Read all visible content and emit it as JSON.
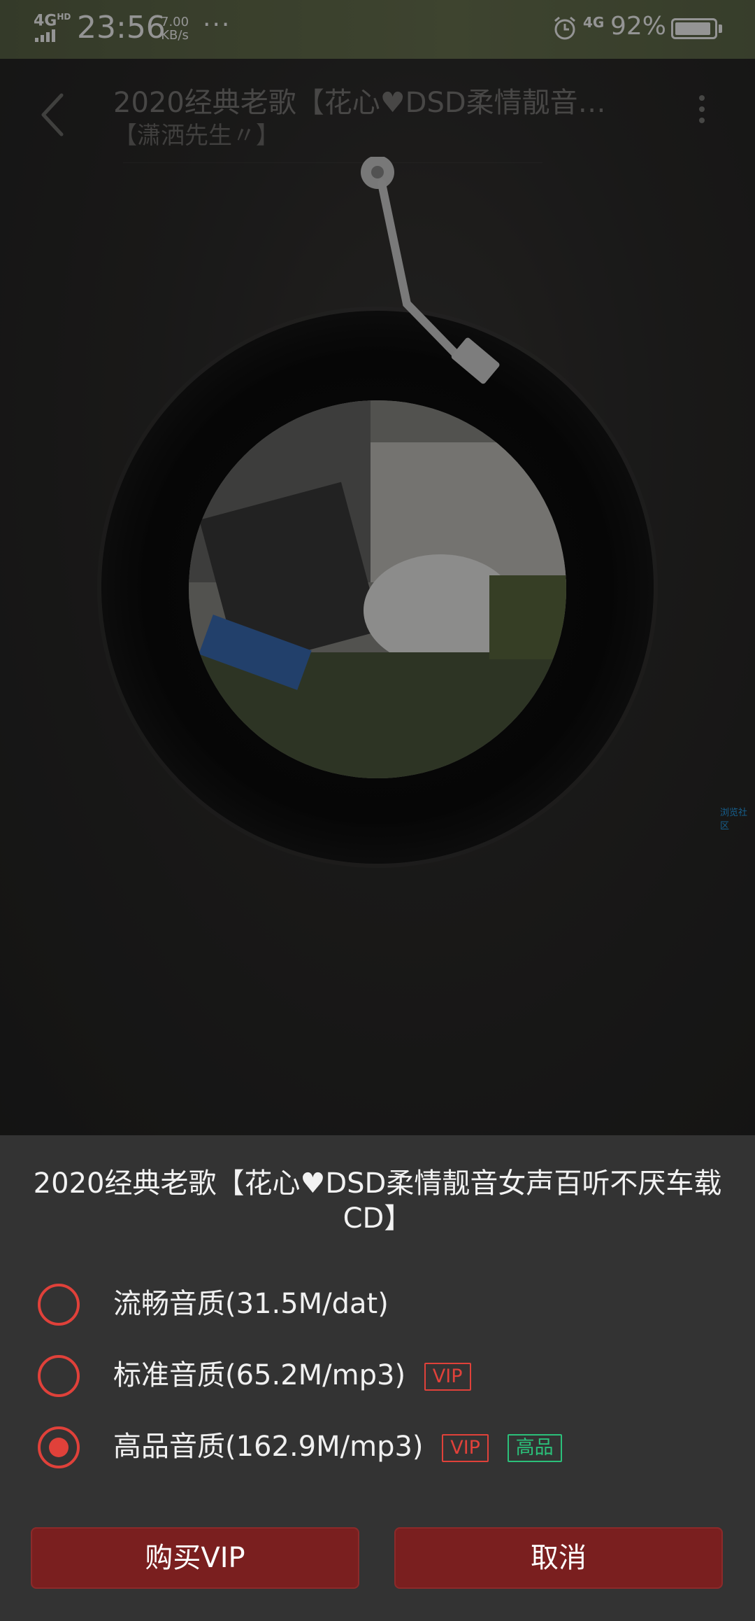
{
  "status_bar": {
    "network": "4G",
    "network_hd": "HD",
    "time": "23:56",
    "speed_value": "7.00",
    "speed_unit": "KB/s",
    "more": "···",
    "right_network": "4G",
    "battery_percent": "92%",
    "battery_level": 0.92
  },
  "player": {
    "title": "2020经典老歌【花心♥DSD柔情靓音…",
    "artist": "【潇洒先生〃】",
    "side_tag": "浏览社区"
  },
  "sheet": {
    "title": "2020经典老歌【花心♥DSD柔情靓音女声百听不厌车载CD】",
    "options": [
      {
        "label": "流畅音质(31.5M/dat)",
        "selected": false,
        "tags": []
      },
      {
        "label": "标准音质(65.2M/mp3)",
        "selected": false,
        "tags": [
          "VIP"
        ]
      },
      {
        "label": "高品音质(162.9M/mp3)",
        "selected": true,
        "tags": [
          "VIP",
          "高品"
        ]
      }
    ],
    "buy_vip_label": "购买VIP",
    "cancel_label": "取消"
  },
  "colors": {
    "accent_red": "#e0413a",
    "hq_green": "#2bc07a",
    "button_bg": "#7a1f1f",
    "sheet_bg": "#333333"
  }
}
